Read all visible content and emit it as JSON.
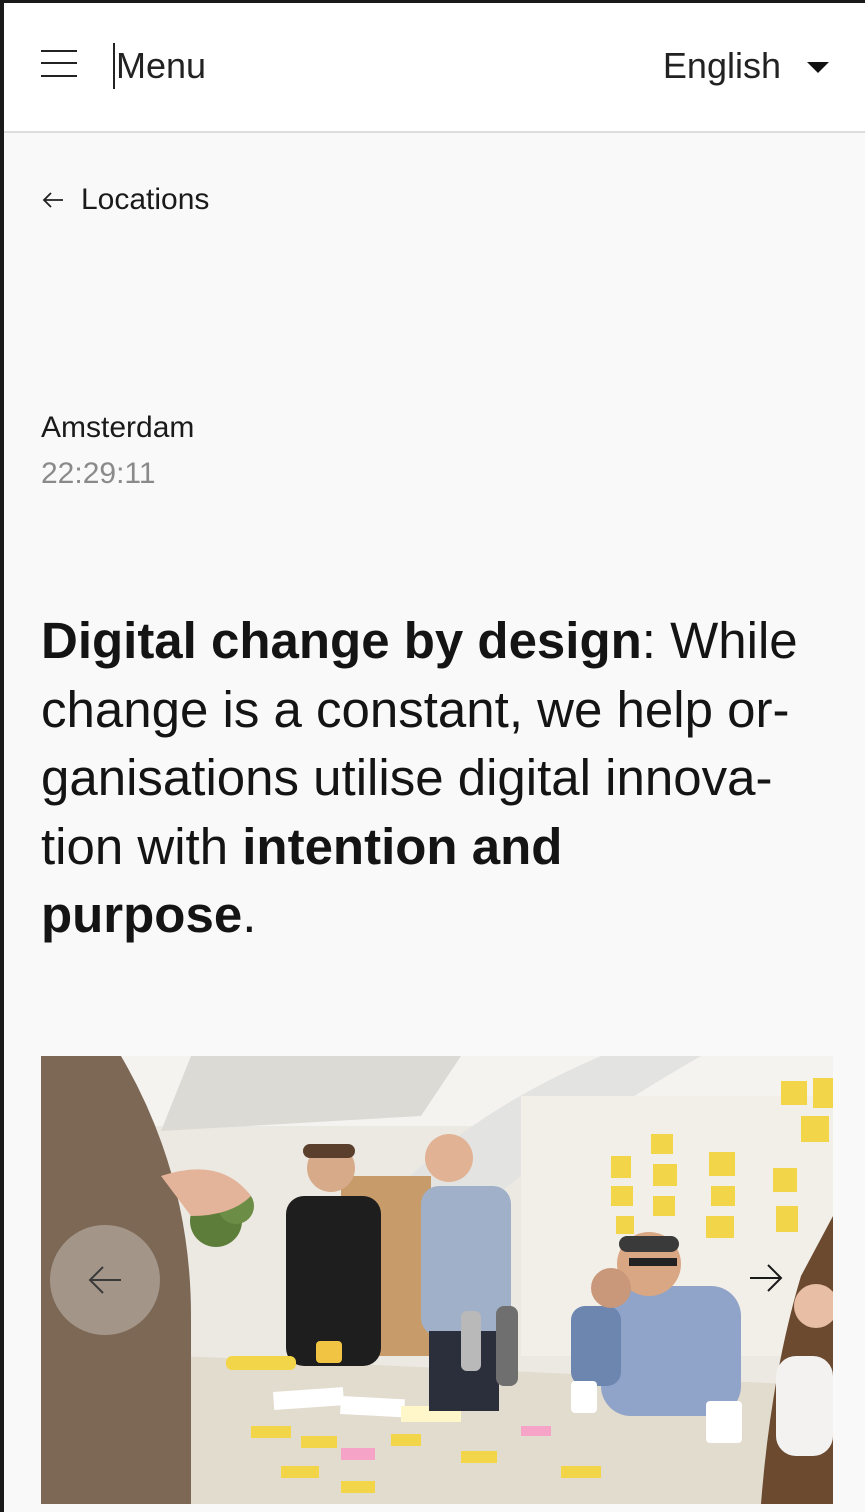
{
  "header": {
    "menu_label": "Menu",
    "language_label": "English"
  },
  "nav": {
    "back_label": "Locations"
  },
  "location": {
    "city": "Amsterdam",
    "time": "22:29:11"
  },
  "headline": {
    "line1_bold": "Digital change by design",
    "line1_rest": ": While",
    "line2": "change is a constant, we help or-",
    "line3": "ganisations utilise digital innova-",
    "line4_start": "tion with ",
    "line4_bold": "intention and",
    "line5_bold": "purpose",
    "line5_end": "."
  },
  "carousel": {
    "image_icon": "team-workshop-photo",
    "prev_icon": "arrow-left-icon",
    "next_icon": "arrow-right-icon"
  },
  "colors": {
    "background": "#f9f9f9",
    "header_bg": "#ffffff",
    "text": "#141414",
    "muted": "#8a8a8a",
    "sticky_note": "#f3d54a"
  }
}
